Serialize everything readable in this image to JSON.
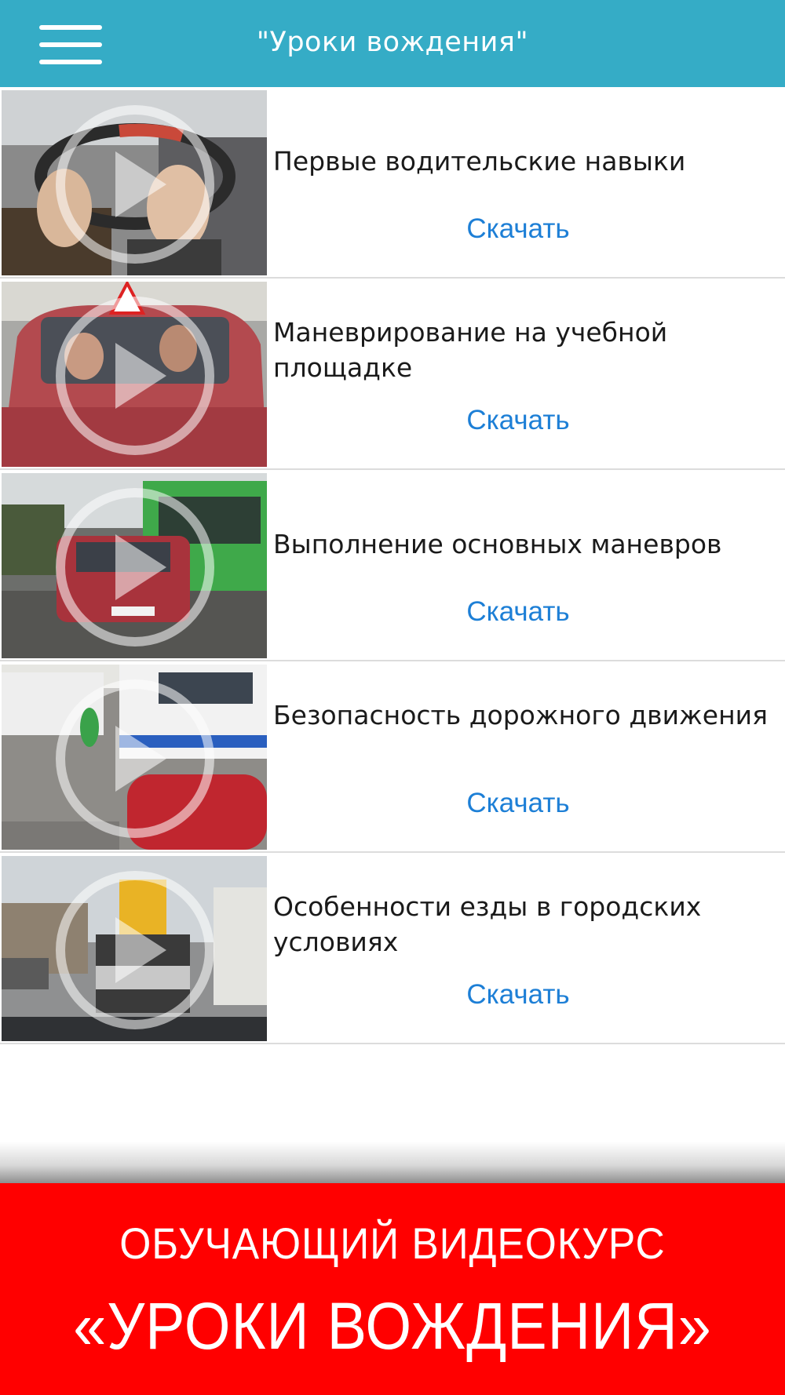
{
  "header": {
    "title": "\"Уроки вождения\"",
    "menu_icon": "hamburger-menu-icon",
    "background_color": "#35acc6"
  },
  "lessons": [
    {
      "title": "Первые водительские навыки",
      "download_label": "Скачать",
      "thumbnail": "steering-wheel-video-thumbnail"
    },
    {
      "title": "Маневрирование на учебной площадке",
      "download_label": "Скачать",
      "thumbnail": "training-car-video-thumbnail"
    },
    {
      "title": "Выполнение основных маневров",
      "download_label": "Скачать",
      "thumbnail": "street-maneuver-video-thumbnail"
    },
    {
      "title": "Безопасность дорожного движения",
      "download_label": "Скачать",
      "thumbnail": "pedestrian-safety-video-thumbnail"
    },
    {
      "title": "Особенности езды в городских условиях",
      "download_label": "Скачать",
      "thumbnail": "city-traffic-video-thumbnail"
    }
  ],
  "banner": {
    "line1": "ОБУЧАЮЩИЙ ВИДЕОКУРС",
    "line2": "«УРОКИ ВОЖДЕНИЯ»",
    "background_color": "#ff0000"
  },
  "colors": {
    "link": "#1d7fd6",
    "divider": "#dcdcdc"
  }
}
